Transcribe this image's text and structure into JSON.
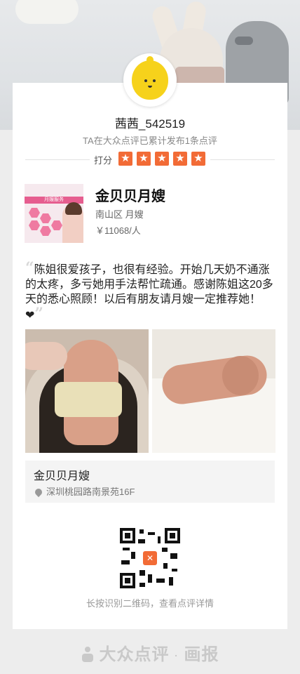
{
  "user": {
    "name": "茜茜_542519",
    "summary": "TA在大众点评已累计发布1条点评",
    "rating_label": "打分",
    "rating_stars": 5,
    "star_color": "#f26b36"
  },
  "shop": {
    "image_text": "月嫂服务",
    "name": "金贝贝月嫂",
    "location": "南山区 月嫂",
    "price": "￥11068/人"
  },
  "review": {
    "text": "陈姐很爱孩子，也很有经验。开始几天奶不通涨的太疼，多亏她用手法帮忙疏通。感谢陈姐这20多天的悉心照顾！以后有朋友请月嫂一定推荐她！",
    "emoji": "❤"
  },
  "address": {
    "name": "金贝贝月嫂",
    "line": "深圳桃园路南景苑16F"
  },
  "qr": {
    "hint": "长按识别二维码，查看点评详情"
  },
  "footer": {
    "brand": "大众点评",
    "sub": "画报"
  }
}
